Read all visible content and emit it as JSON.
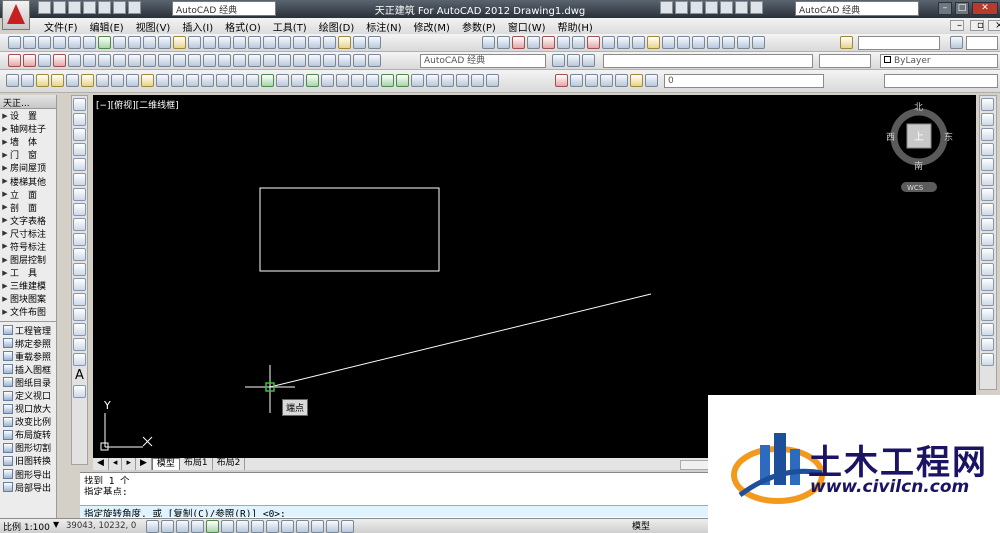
{
  "title": "天正建筑 For AutoCAD 2012    Drawing1.dwg",
  "workspace_dropdown": "AutoCAD 经典",
  "workspace_dropdown_right": "AutoCAD 经典",
  "menu": [
    "文件(F)",
    "编辑(E)",
    "视图(V)",
    "插入(I)",
    "格式(O)",
    "工具(T)",
    "绘图(D)",
    "标注(N)",
    "修改(M)",
    "参数(P)",
    "窗口(W)",
    "帮助(H)"
  ],
  "toolbar2": {
    "workspace_combo": "AutoCAD 经典"
  },
  "toolbar3": {
    "layer_value": "0",
    "color_combo": "ByLayer"
  },
  "palette": {
    "header": "天正...",
    "items": [
      {
        "label": "设　置",
        "spaced": true
      },
      {
        "label": "轴网柱子"
      },
      {
        "label": "墙　体",
        "spaced": true
      },
      {
        "label": "门　窗",
        "spaced": true
      },
      {
        "label": "房间屋顶"
      },
      {
        "label": "楼梯其他"
      },
      {
        "label": "立　面",
        "spaced": true
      },
      {
        "label": "剖　面",
        "spaced": true
      },
      {
        "label": "文字表格"
      },
      {
        "label": "尺寸标注"
      },
      {
        "label": "符号标注"
      },
      {
        "label": "图层控制"
      },
      {
        "label": "工　具",
        "spaced": true
      },
      {
        "label": "三维建模"
      },
      {
        "label": "图块图案"
      },
      {
        "label": "文件布图"
      }
    ],
    "subitems": [
      "工程管理",
      "绑定参照",
      "重载参照",
      "插入图框",
      "图纸目录",
      "定义视口",
      "视口放大",
      "改变比例",
      "布局旋转",
      "图形切割",
      "旧图转换",
      "图形导出",
      "局部导出"
    ]
  },
  "viewport": {
    "label": "[−][俯视][二维线框]",
    "cursor_tooltip": "端点",
    "ucs_y": "Y"
  },
  "viewcube": {
    "north": "北",
    "south": "南",
    "east": "东",
    "west": "西",
    "top": "上",
    "wcs": "WCS"
  },
  "layout_tabs": [
    "模型",
    "布局1",
    "布局2"
  ],
  "command": {
    "lines": [
      "找到 1 个",
      "指定基点:"
    ],
    "prompt": "指定旋转角度, 或 [复制(C)/参照(R)] <0>:"
  },
  "status": {
    "scale": "比例 1:100",
    "coords": "39043, 10232, 0",
    "model_btn": "模型"
  },
  "watermark": {
    "name": "土木工程网",
    "url": "www.civilcn.com"
  }
}
